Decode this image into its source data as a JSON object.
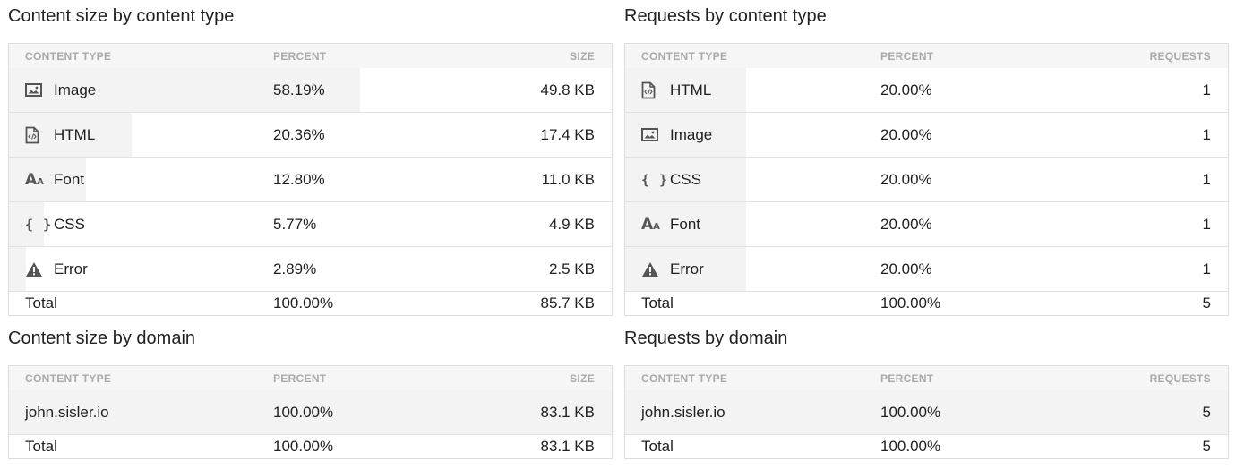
{
  "panels": {
    "size_type": {
      "title": "Content size by content type",
      "headers": {
        "type": "CONTENT TYPE",
        "percent": "PERCENT",
        "value": "SIZE"
      },
      "rows": [
        {
          "label": "Image",
          "percent": "58.19%",
          "value": "49.8 KB",
          "fraction": 0.5819
        },
        {
          "label": "HTML",
          "percent": "20.36%",
          "value": "17.4 KB",
          "fraction": 0.2036
        },
        {
          "label": "Font",
          "percent": "12.80%",
          "value": "11.0 KB",
          "fraction": 0.128
        },
        {
          "label": "CSS",
          "percent": "5.77%",
          "value": "4.9 KB",
          "fraction": 0.0577
        },
        {
          "label": "Error",
          "percent": "2.89%",
          "value": "2.5 KB",
          "fraction": 0.0289
        }
      ],
      "total": {
        "label": "Total",
        "percent": "100.00%",
        "value": "85.7 KB"
      }
    },
    "requests_type": {
      "title": "Requests by content type",
      "headers": {
        "type": "CONTENT TYPE",
        "percent": "PERCENT",
        "value": "REQUESTS"
      },
      "rows": [
        {
          "label": "HTML",
          "percent": "20.00%",
          "value": "1",
          "fraction": 0.2
        },
        {
          "label": "Image",
          "percent": "20.00%",
          "value": "1",
          "fraction": 0.2
        },
        {
          "label": "CSS",
          "percent": "20.00%",
          "value": "1",
          "fraction": 0.2
        },
        {
          "label": "Font",
          "percent": "20.00%",
          "value": "1",
          "fraction": 0.2
        },
        {
          "label": "Error",
          "percent": "20.00%",
          "value": "1",
          "fraction": 0.2
        }
      ],
      "total": {
        "label": "Total",
        "percent": "100.00%",
        "value": "5"
      }
    },
    "size_domain": {
      "title": "Content size by domain",
      "headers": {
        "type": "CONTENT TYPE",
        "percent": "PERCENT",
        "value": "SIZE"
      },
      "rows": [
        {
          "label": "john.sisler.io",
          "percent": "100.00%",
          "value": "83.1 KB",
          "fraction": 1.0
        }
      ],
      "total": {
        "label": "Total",
        "percent": "100.00%",
        "value": "83.1 KB"
      }
    },
    "requests_domain": {
      "title": "Requests by domain",
      "headers": {
        "type": "CONTENT TYPE",
        "percent": "PERCENT",
        "value": "REQUESTS"
      },
      "rows": [
        {
          "label": "john.sisler.io",
          "percent": "100.00%",
          "value": "5",
          "fraction": 1.0
        }
      ],
      "total": {
        "label": "Total",
        "percent": "100.00%",
        "value": "5"
      }
    }
  },
  "icons": {
    "Image": "image-icon",
    "HTML": "html-file-icon",
    "Font": "font-icon",
    "CSS": "css-braces-icon",
    "Error": "warning-icon"
  },
  "colors": {
    "bar": "#f3f3f3",
    "header_bg": "#f6f6f6",
    "header_text": "#a9a9a9"
  }
}
